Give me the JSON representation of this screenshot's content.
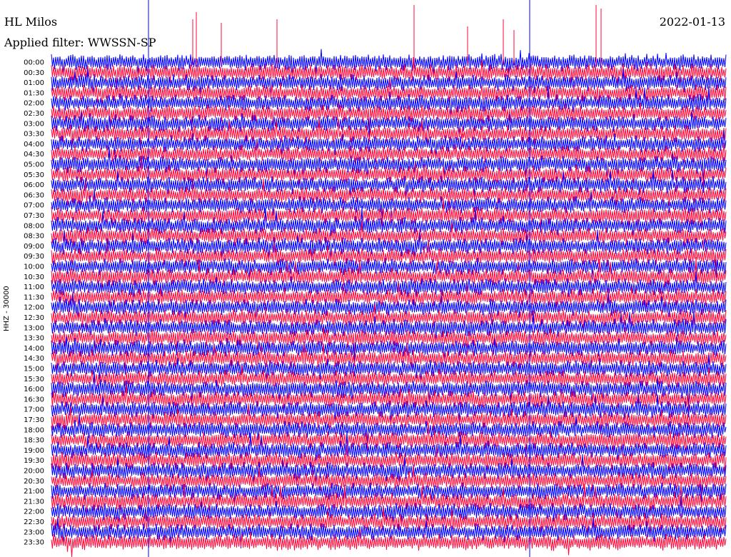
{
  "station": "HL Milos",
  "filter_text": "Applied filter: WWSSN-SP",
  "date": "2022-01-13",
  "channel_label": "HHZ - 30000",
  "colors": {
    "trace_a": "#0000ff",
    "trace_b": "#ff0a3c",
    "background": "#ffffff"
  },
  "chart_data": {
    "type": "line",
    "title": "",
    "xlabel": "",
    "ylabel": "HHZ - 30000",
    "grid": false,
    "legend": "none",
    "row_labels": [
      "00:00",
      "00:30",
      "01:00",
      "01:30",
      "02:00",
      "02:30",
      "03:00",
      "03:30",
      "04:00",
      "04:30",
      "05:00",
      "05:30",
      "06:00",
      "06:30",
      "07:00",
      "07:30",
      "08:00",
      "08:30",
      "09:00",
      "09:30",
      "10:00",
      "10:30",
      "11:00",
      "11:30",
      "12:00",
      "12:30",
      "13:00",
      "13:30",
      "14:00",
      "14:30",
      "15:00",
      "15:30",
      "16:00",
      "16:30",
      "17:00",
      "17:30",
      "18:00",
      "18:30",
      "19:00",
      "19:30",
      "20:00",
      "20:30",
      "21:00",
      "21:30",
      "22:00",
      "22:30",
      "23:00",
      "23:30"
    ],
    "series_colors": [
      "#0000ff",
      "#ff0a3c"
    ]
  }
}
